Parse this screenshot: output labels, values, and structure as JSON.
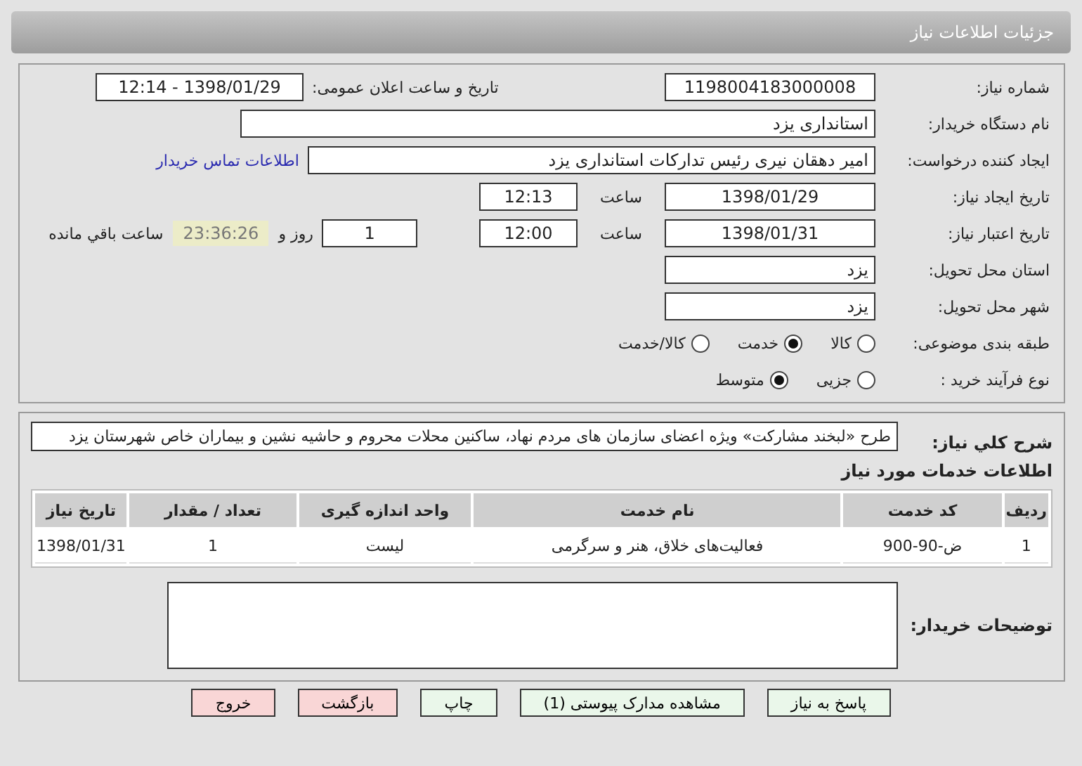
{
  "header": {
    "title": "جزئیات اطلاعات نیاز"
  },
  "need_number": {
    "label": "شماره نیاز:",
    "value": "1198004183000008"
  },
  "announce": {
    "label": "تاریخ و ساعت اعلان عمومی:",
    "value": "1398/01/29 - 12:14"
  },
  "buyer": {
    "label": "نام دستگاه خریدار:",
    "value": "استانداری یزد"
  },
  "requester": {
    "label": "ایجاد کننده درخواست:",
    "value": "امیر دهقان نیری رئیس تداركات استانداری یزد",
    "contact_link": "اطلاعات تماس خریدار"
  },
  "created": {
    "label": "تاریخ ایجاد نیاز:",
    "date": "1398/01/29",
    "time_label": "ساعت",
    "time": "12:13"
  },
  "validity": {
    "label": "تاریخ اعتبار نیاز:",
    "date": "1398/01/31",
    "time_label": "ساعت",
    "time": "12:00",
    "days": "1",
    "days_label": "روز و",
    "remaining": "23:36:26",
    "remaining_label": "ساعت باقي مانده"
  },
  "province": {
    "label": "استان محل تحویل:",
    "value": "یزد"
  },
  "city": {
    "label": "شهر محل تحویل:",
    "value": "یزد"
  },
  "category": {
    "label": "طبقه بندی موضوعی:",
    "options": [
      {
        "label": "کالا",
        "selected": false
      },
      {
        "label": "خدمت",
        "selected": true
      },
      {
        "label": "کالا/خدمت",
        "selected": false
      }
    ]
  },
  "process": {
    "label": "نوع فرآیند خرید :",
    "options": [
      {
        "label": "جزیی",
        "selected": false
      },
      {
        "label": "متوسط",
        "selected": true
      }
    ]
  },
  "description": {
    "label": "شرح کلي نياز:",
    "text": "طرح «لبخند مشارکت» ویژه اعضای سازمان های مردم نهاد، ساکنین محلات محروم و حاشیه نشین و بیماران خاص شهرستان یزد"
  },
  "services": {
    "title": "اطلاعات خدمات مورد نیاز",
    "columns": [
      "ردیف",
      "کد خدمت",
      "نام خدمت",
      "واحد اندازه گیری",
      "تعداد / مقدار",
      "تاریخ نیاز"
    ],
    "rows": [
      [
        "1",
        "ض-90-900",
        "فعالیت‌های خلاق، هنر و سرگرمی",
        "لیست",
        "1",
        "1398/01/31"
      ]
    ]
  },
  "buyer_notes": {
    "label": "توضیحات خریدار:"
  },
  "buttons": [
    {
      "label": "پاسخ به نیاز",
      "color": "#eaf7ea"
    },
    {
      "label": "مشاهده مدارک پیوستی (1)",
      "color": "#eaf7ea"
    },
    {
      "label": "چاپ",
      "color": "#eaf7ea"
    },
    {
      "label": "بازگشت",
      "color": "#f9d6d6"
    },
    {
      "label": "خروج",
      "color": "#f9d6d6"
    }
  ]
}
